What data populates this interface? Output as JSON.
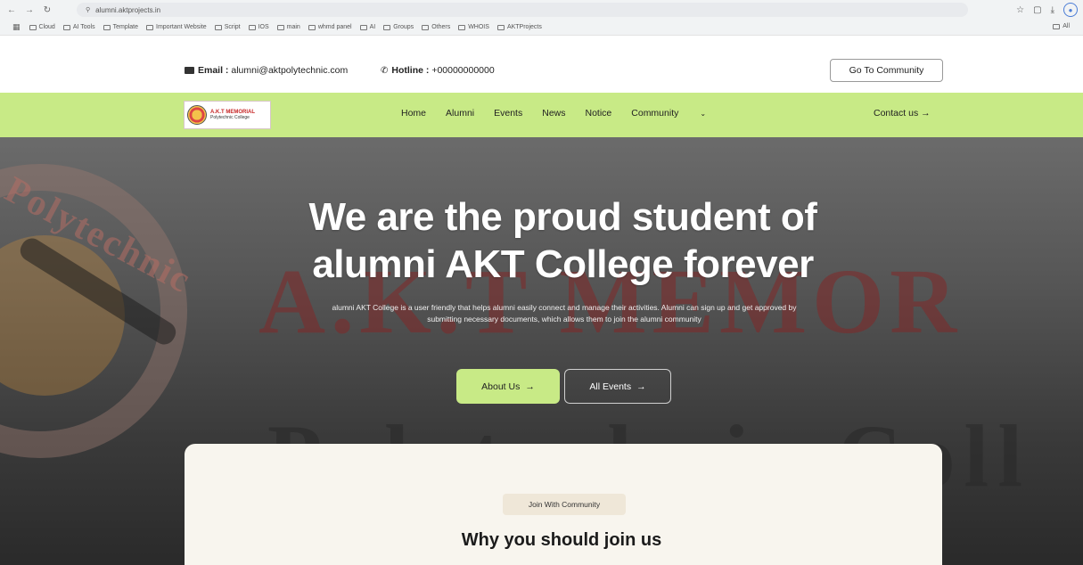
{
  "browser": {
    "url": "alumni.aktprojects.in",
    "bookmarks": [
      "Cloud",
      "AI Tools",
      "Template",
      "Important Website",
      "Script",
      "IOS",
      "main",
      "whmd panel",
      "AI",
      "Groups",
      "Others",
      "WHOIS",
      "AKTProjects"
    ],
    "bookmark_right": "All"
  },
  "topbar": {
    "email_label": "Email :",
    "email_value": "alumni@aktpolytechnic.com",
    "hotline_label": "Hotline :",
    "hotline_value": "+00000000000",
    "community_button": "Go To Community"
  },
  "nav": {
    "logo_line1": "A.K.T MEMORIAL",
    "logo_line2": "Polytechnic College",
    "links": [
      "Home",
      "Alumni",
      "Events",
      "News",
      "Notice",
      "Community"
    ],
    "contact": "Contact us",
    "arrow": "→"
  },
  "hero": {
    "title_line1": "We are the proud student of",
    "title_line2": "alumni AKT College forever",
    "description": "alumni AKT College is a user friendly that helps alumni easily connect and manage their activities. Alumni can sign up and get approved by submitting necessary documents, which allows them to join the alumni community",
    "about_button": "About Us",
    "events_button": "All Events",
    "bg_text_top": "Polytechnic",
    "bg_text_big": "A.K.T MEMOR",
    "bg_text_bottom": "Polytechnic Coll"
  },
  "join": {
    "badge": "Join With Community",
    "title": "Why you should join us"
  },
  "colors": {
    "accent_green": "#c8ea86",
    "card_bg": "#f8f5ee"
  }
}
